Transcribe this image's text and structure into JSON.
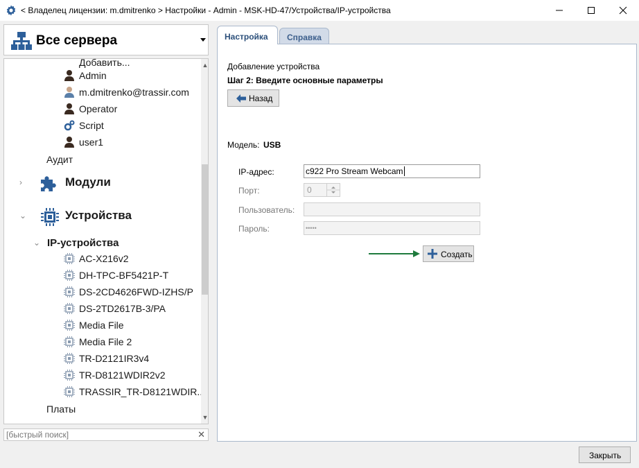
{
  "window": {
    "title": "< Владелец лицензии: m.dmitrenko > Настройки - Admin - MSK-HD-47/Устройства/IP-устройства"
  },
  "server_selector": {
    "label": "Все сервера"
  },
  "tree": {
    "cutoff_label": "Добавить...",
    "users": [
      {
        "label": "Admin",
        "icon": "user-icon"
      },
      {
        "label": "m.dmitrenko@trassir.com",
        "icon": "user-icon"
      },
      {
        "label": "Operator",
        "icon": "user-icon"
      },
      {
        "label": "Script",
        "icon": "script-icon"
      },
      {
        "label": "user1",
        "icon": "user-icon"
      }
    ],
    "audit": "Аудит",
    "modules": "Модули",
    "devices": "Устройства",
    "ip_devices": "IP-устройства",
    "ip_device_items": [
      "AC-X216v2",
      "DH-TPC-BF5421P-T",
      "DS-2CD4626FWD-IZHS/P",
      "DS-2TD2617B-3/PA",
      "Media File",
      "Media File 2",
      "TR-D2121IR3v4",
      "TR-D8121WDIR2v2",
      "TRASSIR_TR-D8121WDIR..."
    ],
    "boards": "Платы"
  },
  "search": {
    "placeholder": "[быстрый поиск]"
  },
  "tabs": [
    {
      "label": "Настройка",
      "active": true
    },
    {
      "label": "Справка",
      "active": false
    }
  ],
  "form": {
    "heading": "Добавление устройства",
    "step": "Шаг 2: Введите основные параметры",
    "back_label": "Назад",
    "model_label": "Модель:",
    "model_value": "USB",
    "fields": {
      "ip": {
        "label": "IP-адрес:",
        "value": "c922 Pro Stream Webcam"
      },
      "port": {
        "label": "Порт:",
        "value": "0"
      },
      "user": {
        "label": "Пользователь:",
        "value": ""
      },
      "password": {
        "label": "Пароль:",
        "value": "•••••"
      }
    },
    "create_label": "Создать"
  },
  "footer": {
    "close_label": "Закрыть"
  },
  "colors": {
    "tab_text": "#2b4f7a",
    "accent_arrow": "#1e7a3c",
    "icon_blue": "#2d5f9a"
  }
}
